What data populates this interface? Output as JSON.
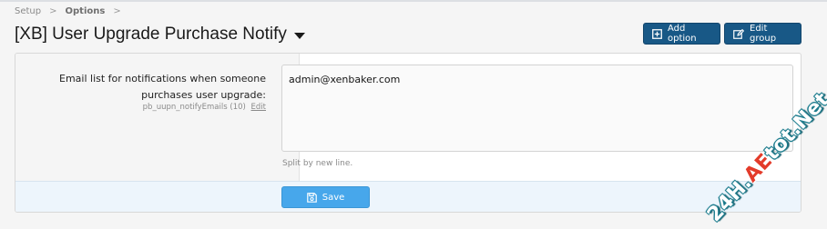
{
  "breadcrumb": {
    "items": [
      "Setup",
      "Options"
    ],
    "separator": ">"
  },
  "page": {
    "title": "[XB] User Upgrade Purchase Notify"
  },
  "header_buttons": {
    "add_option": "Add option",
    "edit_group": "Edit group"
  },
  "option": {
    "label": "Email list for notifications when someone purchases user upgrade:",
    "meta": "pb_uupn_notifyEmails (10)",
    "edit_link": "Edit",
    "value": "admin@xenbaker.com",
    "hint": "Split by new line."
  },
  "footer": {
    "save_label": "Save"
  },
  "watermark": {
    "prefix": "24H.",
    "highlight": "AE",
    "suffix": "tot.Net"
  },
  "colors": {
    "primary_button": "#185886",
    "save_button": "#47a7eb",
    "footer_bg": "#edf5fc",
    "page_bg": "#f5f5f5"
  },
  "icons": {
    "add_option": "plus-square-icon",
    "edit_group": "edit-icon",
    "save": "save-icon",
    "title_menu": "caret-down-icon"
  }
}
